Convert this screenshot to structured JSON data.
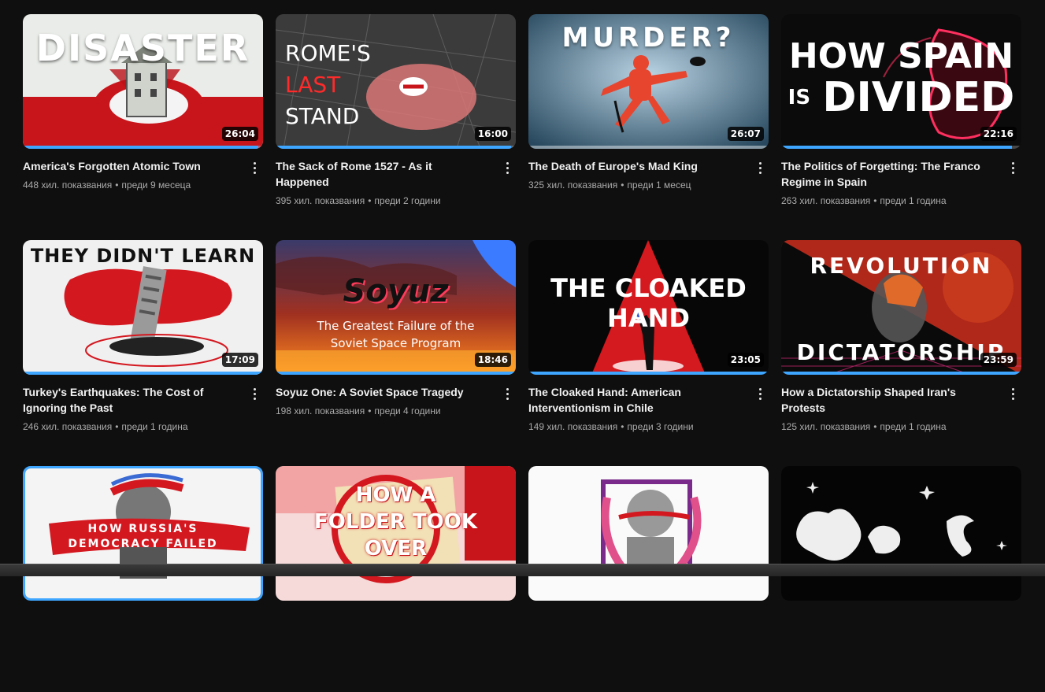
{
  "videos": [
    {
      "title": "America's Forgotten Atomic Town",
      "views": "448 хил. показвания",
      "age": "преди 9 месеца",
      "duration": "26:04",
      "progress": 0.98,
      "thumb_text": [
        "DISASTER"
      ]
    },
    {
      "title": "The Sack of Rome 1527 - As it Happened",
      "views": "395 хил. показвания",
      "age": "преди 2 години",
      "duration": "16:00",
      "progress": 0.98,
      "thumb_text": [
        "ROME'S",
        "LAST",
        "STAND"
      ]
    },
    {
      "title": "The Death of Europe's Mad King",
      "views": "325 хил. показвания",
      "age": "преди 1 месец",
      "duration": "26:07",
      "progress": 0.0,
      "thumb_text": [
        "MURDER?"
      ]
    },
    {
      "title": "The Politics of Forgetting: The Franco Regime in Spain",
      "views": "263 хил. показвания",
      "age": "преди 1 година",
      "duration": "22:16",
      "progress": 0.96,
      "thumb_text": [
        "HOW SPAIN",
        "IS",
        "DIVIDED"
      ]
    },
    {
      "title": "Turkey's Earthquakes: The Cost of Ignoring the Past",
      "views": "246 хил. показвания",
      "age": "преди 1 година",
      "duration": "17:09",
      "progress": 1.0,
      "thumb_text": [
        "THEY DIDN'T LEARN"
      ]
    },
    {
      "title": "Soyuz One: A Soviet Space Tragedy",
      "views": "198 хил. показвания",
      "age": "преди 4 години",
      "duration": "18:46",
      "progress": 1.0,
      "thumb_text": [
        "Soyuz",
        "The Greatest Failure of the",
        "Soviet Space Program"
      ]
    },
    {
      "title": "The Cloaked Hand: American Interventionism in Chile",
      "views": "149 хил. показвания",
      "age": "преди 3 години",
      "duration": "23:05",
      "progress": 1.0,
      "thumb_text": [
        "THE CLOAKED HAND"
      ]
    },
    {
      "title": "How a Dictatorship Shaped Iran's Protests",
      "views": "125 хил. показвания",
      "age": "преди 1 година",
      "duration": "23:59",
      "progress": 1.0,
      "thumb_text": [
        "REVOLUTION",
        "DICTATORSHIP"
      ]
    },
    {
      "thumb_text": [
        "HOW RUSSIA'S",
        "DEMOCRACY FAILED"
      ]
    },
    {
      "thumb_text": [
        "HOW A",
        "FOLDER TOOK",
        "OVER"
      ]
    },
    {
      "thumb_text": []
    },
    {
      "thumb_text": []
    }
  ],
  "colors": {
    "progress": "#3ea6ff",
    "bg": "#0f0f0f",
    "meta": "#aaaaaa"
  },
  "icons": {
    "more": "more-vert-icon"
  }
}
